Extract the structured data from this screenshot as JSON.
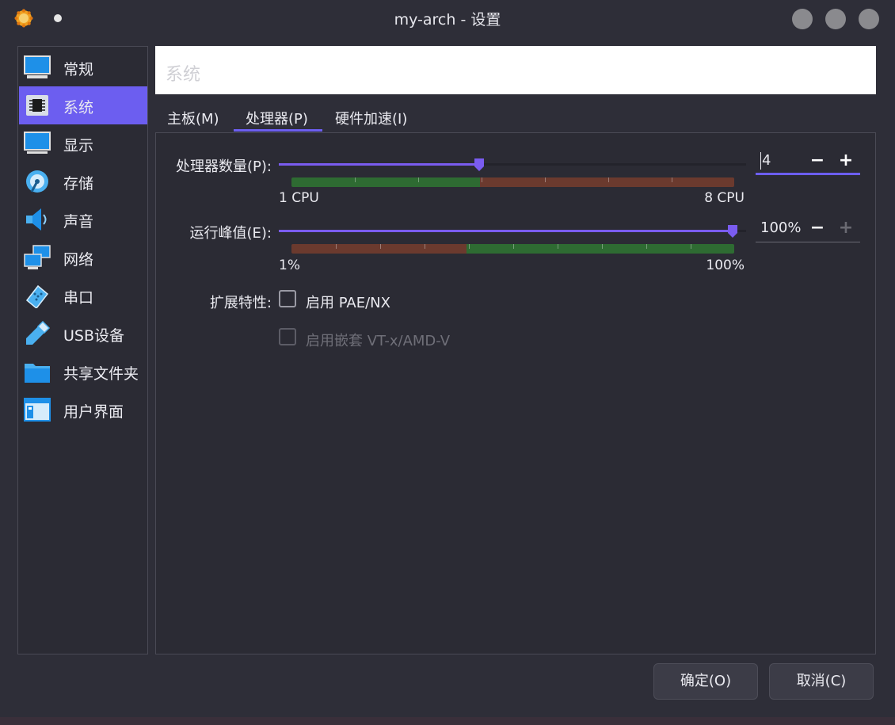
{
  "window": {
    "title": "my-arch - 设置",
    "colors": {
      "accent": "#6c5ef0",
      "green": "#2e6b32",
      "red": "#6b3a2e"
    }
  },
  "sidebar": {
    "items": [
      {
        "label": "常规",
        "icon": "monitor-icon"
      },
      {
        "label": "系统",
        "icon": "chip-icon",
        "active": true
      },
      {
        "label": "显示",
        "icon": "display-icon"
      },
      {
        "label": "存储",
        "icon": "disk-icon"
      },
      {
        "label": "声音",
        "icon": "speaker-icon"
      },
      {
        "label": "网络",
        "icon": "network-icon"
      },
      {
        "label": "串口",
        "icon": "serial-port-icon"
      },
      {
        "label": "USB设备",
        "icon": "usb-icon"
      },
      {
        "label": "共享文件夹",
        "icon": "folder-icon"
      },
      {
        "label": "用户界面",
        "icon": "ui-window-icon"
      }
    ]
  },
  "header": {
    "title": "系统"
  },
  "tabs": [
    {
      "label": "主板(M)"
    },
    {
      "label": "处理器(P)",
      "active": true
    },
    {
      "label": "硬件加速(I)"
    }
  ],
  "processor": {
    "cpu_count": {
      "label": "处理器数量(P):",
      "value": "4",
      "min_label": "1 CPU",
      "max_label": "8 CPU",
      "min": 1,
      "max": 8,
      "current": 4
    },
    "execution_cap": {
      "label": "运行峰值(E):",
      "value": "100%",
      "min_label": "1%",
      "max_label": "100%",
      "min": 1,
      "max": 100,
      "current": 100
    },
    "extended_features": {
      "label": "扩展特性:",
      "pae_nx": {
        "label": "启用 PAE/NX",
        "checked": false,
        "enabled": true
      },
      "nested_vtx": {
        "label": "启用嵌套 VT-x/AMD-V",
        "checked": false,
        "enabled": false
      }
    },
    "spin_minus": "−",
    "spin_plus": "+"
  },
  "buttons": {
    "ok": "确定(O)",
    "cancel": "取消(C)"
  }
}
